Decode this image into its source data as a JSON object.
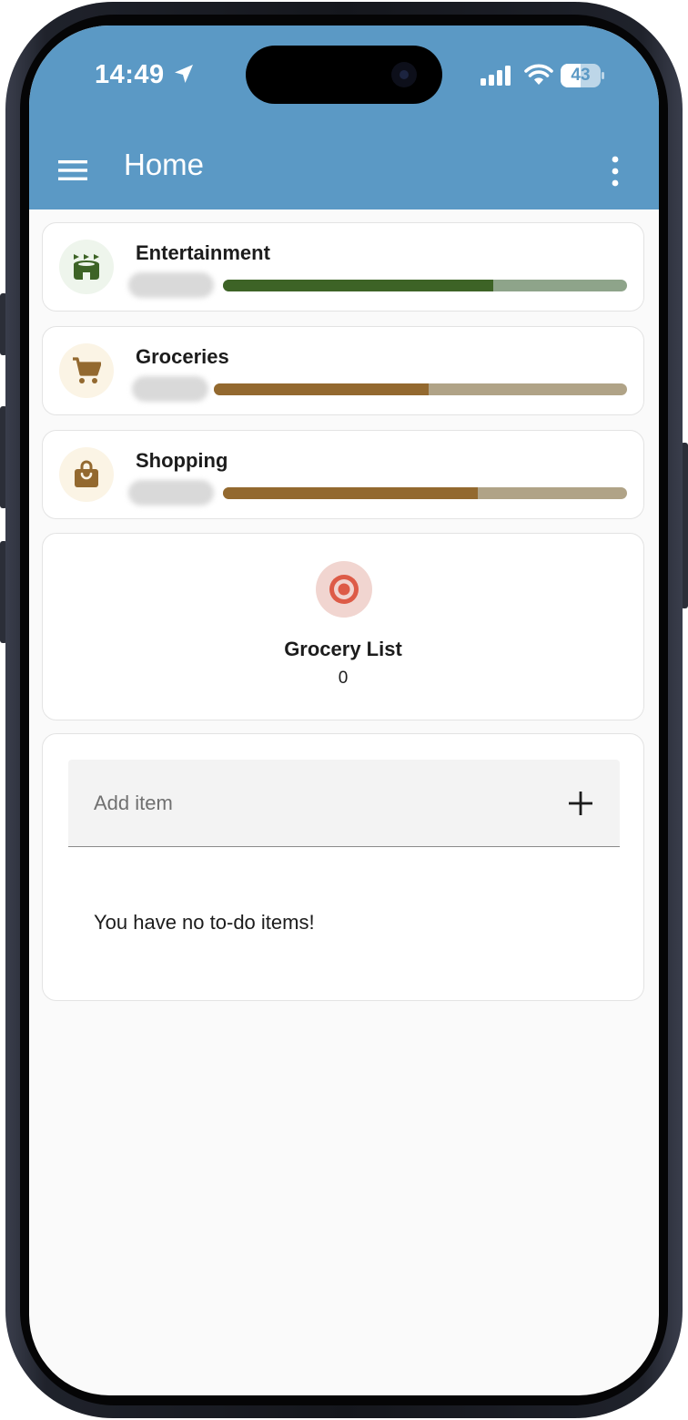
{
  "status_bar": {
    "time": "14:49",
    "battery": "43"
  },
  "app_bar": {
    "title": "Home"
  },
  "budgets": [
    {
      "name": "Entertainment",
      "progress": 0.67,
      "icon": "stadium-icon",
      "color": "#3d6326",
      "track_color": "#8ea48a",
      "icon_bg": "#eef5ec"
    },
    {
      "name": "Groceries",
      "progress": 0.52,
      "icon": "cart-icon",
      "color": "#93692f",
      "track_color": "#b0a387",
      "icon_bg": "#fbf4e5"
    },
    {
      "name": "Shopping",
      "progress": 0.63,
      "icon": "shopping-bag-icon",
      "color": "#93692f",
      "track_color": "#b0a387",
      "icon_bg": "#fbf4e5"
    }
  ],
  "grocery_target": {
    "name": "Grocery List",
    "count": "0",
    "icon": "target-icon",
    "color": "#dd5b47"
  },
  "todo": {
    "placeholder": "Add item",
    "empty_message": "You have no to-do items!"
  },
  "colors": {
    "accent": "#5b99c5",
    "background": "#fafafa"
  }
}
